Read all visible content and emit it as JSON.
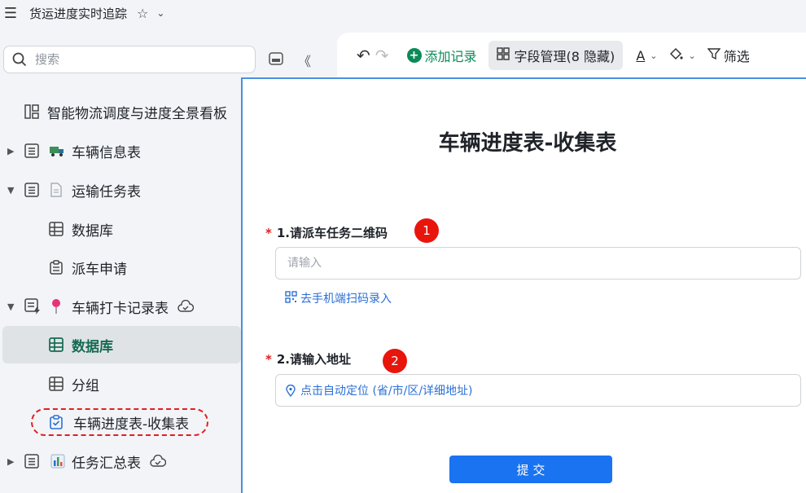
{
  "header": {
    "app_title": "货运进度实时追踪"
  },
  "search": {
    "placeholder": "搜索"
  },
  "toolbar": {
    "add_record": "添加记录",
    "field_manage": "字段管理(8 隐藏)",
    "font_label": "A",
    "filter_label": "筛选"
  },
  "sidebar": {
    "items": [
      {
        "label": "智能物流调度与进度全景看板"
      },
      {
        "label": "车辆信息表"
      },
      {
        "label": "运输任务表"
      },
      {
        "label": "数据库"
      },
      {
        "label": "派车申请"
      },
      {
        "label": "车辆打卡记录表"
      },
      {
        "label": "数据库"
      },
      {
        "label": "分组"
      },
      {
        "label": "车辆进度表-收集表"
      },
      {
        "label": "任务汇总表"
      }
    ]
  },
  "form": {
    "title": "车辆进度表-收集表",
    "q1": {
      "label": "1.请派车任务二维码",
      "required_mark": "*",
      "placeholder": "请输入",
      "scan_link": "去手机端扫码录入",
      "badge": "1"
    },
    "q2": {
      "label": "2.请输入地址",
      "required_mark": "*",
      "location_text": "点击自动定位 (省/市/区/详细地址)",
      "badge": "2"
    },
    "submit_label": "提 交"
  },
  "colors": {
    "accent_green": "#156b51",
    "add_green": "#0b8a58",
    "primary_blue": "#1a73f0",
    "annotation_red": "#e02020"
  }
}
